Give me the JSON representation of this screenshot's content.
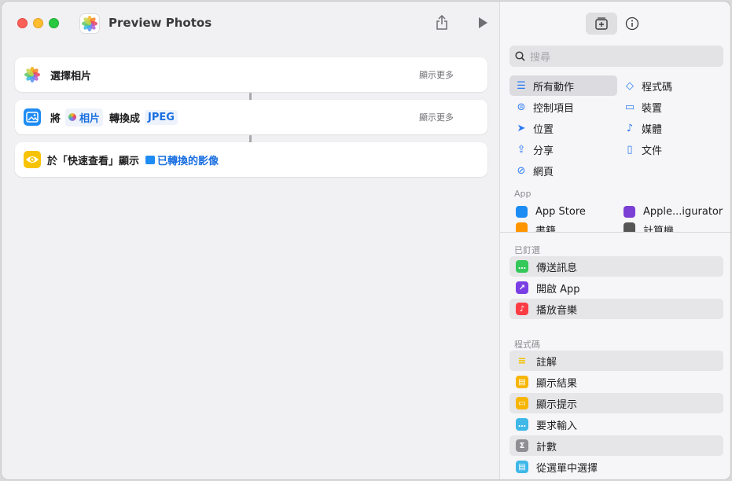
{
  "window": {
    "title": "Preview Photos"
  },
  "actions": [
    {
      "label": "選擇相片",
      "more": "顯示更多"
    },
    {
      "prefix": "將",
      "chip1": "相片",
      "middle": "轉換成",
      "chip2": "JPEG",
      "more": "顯示更多"
    },
    {
      "prefix": "於「快速查看」顯示",
      "chip1": "已轉換的影像"
    }
  ],
  "sidebar": {
    "search_placeholder": "搜尋",
    "categories": [
      {
        "label": "所有動作",
        "icon": "list-icon"
      },
      {
        "label": "程式碼",
        "icon": "code-icon"
      },
      {
        "label": "控制項目",
        "icon": "toggle-icon"
      },
      {
        "label": "裝置",
        "icon": "display-icon"
      },
      {
        "label": "位置",
        "icon": "location-icon"
      },
      {
        "label": "媒體",
        "icon": "music-note-icon"
      },
      {
        "label": "分享",
        "icon": "share-icon"
      },
      {
        "label": "文件",
        "icon": "document-icon"
      },
      {
        "label": "網頁",
        "icon": "compass-icon"
      }
    ],
    "app_section": "App",
    "apps": [
      {
        "label": "App Store",
        "color": "#1c8cf2"
      },
      {
        "label": "Apple...igurator",
        "color": "#7b3fd6"
      },
      {
        "label": "書籍",
        "color": "#ff9500"
      },
      {
        "label": "計算機",
        "color": "#555555"
      }
    ],
    "pinned_section": "已釘選",
    "pinned": [
      {
        "label": "傳送訊息",
        "color": "#34c759",
        "glyph": "…"
      },
      {
        "label": "開啟 App",
        "color": "#7a3fe4",
        "glyph": "↗"
      },
      {
        "label": "播放音樂",
        "color": "#fc3c44",
        "glyph": "♪"
      }
    ],
    "code_section": "程式碼",
    "code": [
      {
        "label": "註解",
        "color": "#f7d14c",
        "glyph": "≡"
      },
      {
        "label": "顯示結果",
        "color": "#f7b500",
        "glyph": "▤"
      },
      {
        "label": "顯示提示",
        "color": "#f7b500",
        "glyph": "▭"
      },
      {
        "label": "要求輸入",
        "color": "#3fb8e8",
        "glyph": "…"
      },
      {
        "label": "計數",
        "color": "#8e8e93",
        "glyph": "Σ"
      },
      {
        "label": "從選單中選擇",
        "color": "#3fb8e8",
        "glyph": "▤"
      }
    ]
  }
}
